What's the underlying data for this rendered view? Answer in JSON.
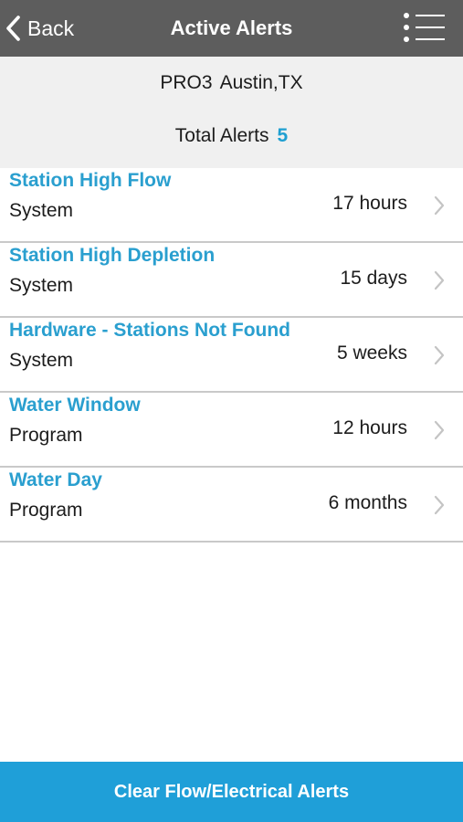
{
  "navbar": {
    "back_label": "Back",
    "title": "Active Alerts",
    "back_icon": "chevron-left-icon",
    "menu_icon": "list-menu-icon",
    "background": "#5d5d5d"
  },
  "summary": {
    "controller": "PRO3",
    "location": "Austin,TX",
    "total_label": "Total Alerts",
    "total_count": "5"
  },
  "alerts": [
    {
      "title": "Station High Flow",
      "category": "System",
      "age": "17 hours"
    },
    {
      "title": "Station High Depletion",
      "category": "System",
      "age": "15 days"
    },
    {
      "title": "Hardware - Stations Not Found",
      "category": "System",
      "age": "5 weeks"
    },
    {
      "title": "Water Window",
      "category": "Program",
      "age": "12 hours"
    },
    {
      "title": "Water Day",
      "category": "Program",
      "age": "6 months"
    }
  ],
  "actions": {
    "clear_label": "Clear Flow/Electrical Alerts"
  },
  "colors": {
    "accent": "#1f9fd8",
    "title_blue": "#2a9fcf",
    "summary_bg": "#f0f0f0",
    "divider": "#c9c9c9"
  }
}
